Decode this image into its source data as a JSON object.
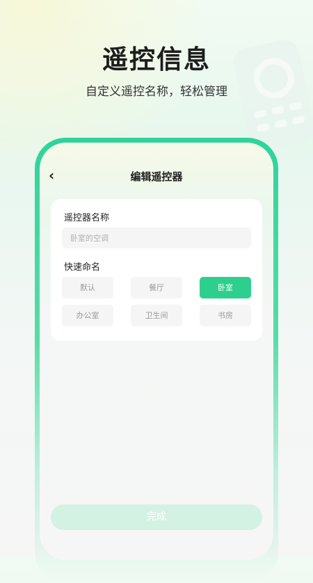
{
  "promo": {
    "headline": "遥控信息",
    "subline": "自定义遥控名称，轻松管理"
  },
  "header": {
    "back_icon": "‹",
    "title": "编辑遥控器"
  },
  "form": {
    "name_label": "遥控器名称",
    "name_placeholder": "卧室的空调",
    "name_value": "",
    "quick_label": "快速命名",
    "quick_options": [
      "默认",
      "餐厅",
      "卧室",
      "办公室",
      "卫生间",
      "书房"
    ],
    "selected_option": "卧室"
  },
  "footer": {
    "done_label": "完成"
  },
  "colors": {
    "accent": "#2dcf8e",
    "done_disabled": "#d4f2e4"
  }
}
